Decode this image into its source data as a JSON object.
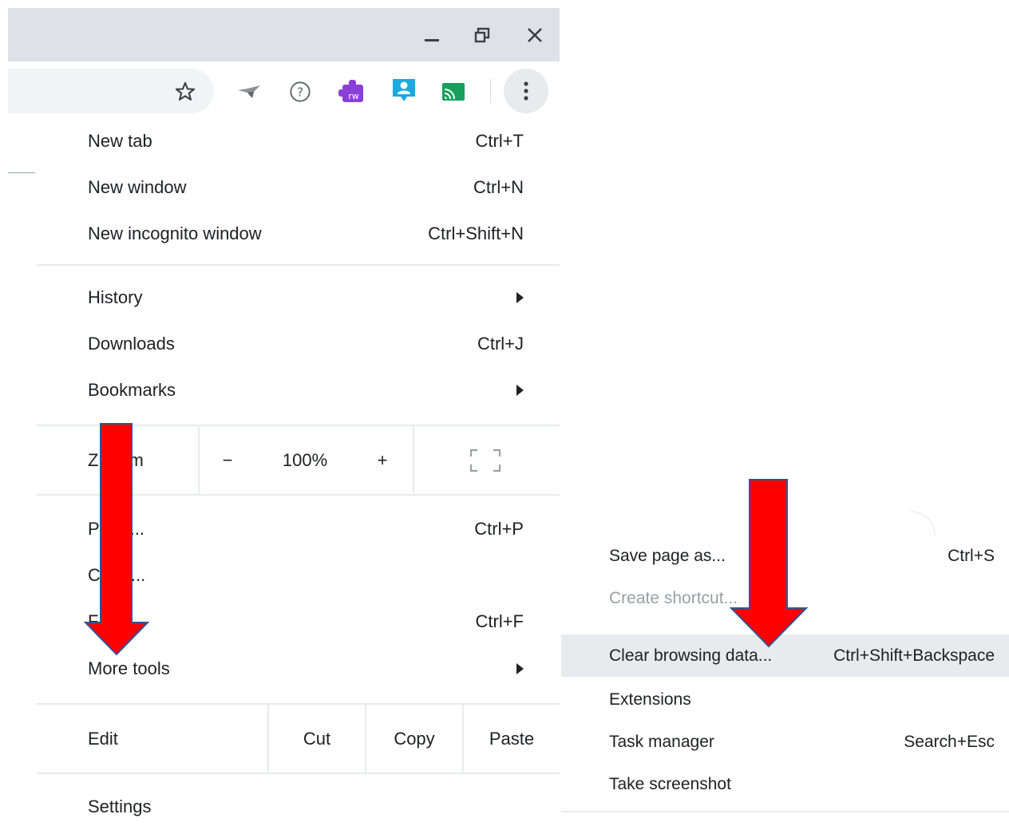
{
  "window_controls": {
    "minimize_glyph": "—",
    "restore_glyph": "❐",
    "close_glyph": "✕"
  },
  "toolbar": {
    "icons": [
      "star-icon",
      "extension-wing-icon",
      "help-circle-icon",
      "rw-extension-icon",
      "account-badge-icon",
      "cast-icon",
      "more-vert-icon"
    ],
    "rw_badge_text": "rw"
  },
  "menu": {
    "new_tab": {
      "label": "New tab",
      "shortcut": "Ctrl+T"
    },
    "new_window": {
      "label": "New window",
      "shortcut": "Ctrl+N"
    },
    "new_incognito": {
      "label": "New incognito window",
      "shortcut": "Ctrl+Shift+N"
    },
    "history": {
      "label": "History"
    },
    "downloads": {
      "label": "Downloads",
      "shortcut": "Ctrl+J"
    },
    "bookmarks": {
      "label": "Bookmarks"
    },
    "zoom": {
      "label_visible": "Z",
      "label_tail": "m",
      "minus": "−",
      "value": "100%",
      "plus": "+"
    },
    "print": {
      "label_visible": "P",
      "label_tail": "...",
      "shortcut": "Ctrl+P"
    },
    "cast": {
      "label_visible": "C",
      "label_tail": "..."
    },
    "find": {
      "label_visible": "F",
      "shortcut": "Ctrl+F"
    },
    "more_tools": {
      "label": "More tools"
    },
    "edit": {
      "label": "Edit",
      "cut": "Cut",
      "copy": "Copy",
      "paste": "Paste"
    },
    "settings": {
      "label": "Settings"
    }
  },
  "submenu": {
    "items": [
      {
        "label": "Save page as...",
        "shortcut": "Ctrl+S"
      },
      {
        "label": "Create shortcut...",
        "shortcut": ""
      },
      {
        "label": "Clear browsing data...",
        "shortcut": "Ctrl+Shift+Backspace"
      },
      {
        "label": "Extensions",
        "shortcut": ""
      },
      {
        "label": "Task manager",
        "shortcut": "Search+Esc"
      },
      {
        "label": "Take screenshot",
        "shortcut": ""
      }
    ]
  },
  "colors": {
    "titlebar": "#dee1e6",
    "highlight": "#e8eaed",
    "arrow_fill": "#ff0000",
    "arrow_stroke": "#2f5597"
  }
}
